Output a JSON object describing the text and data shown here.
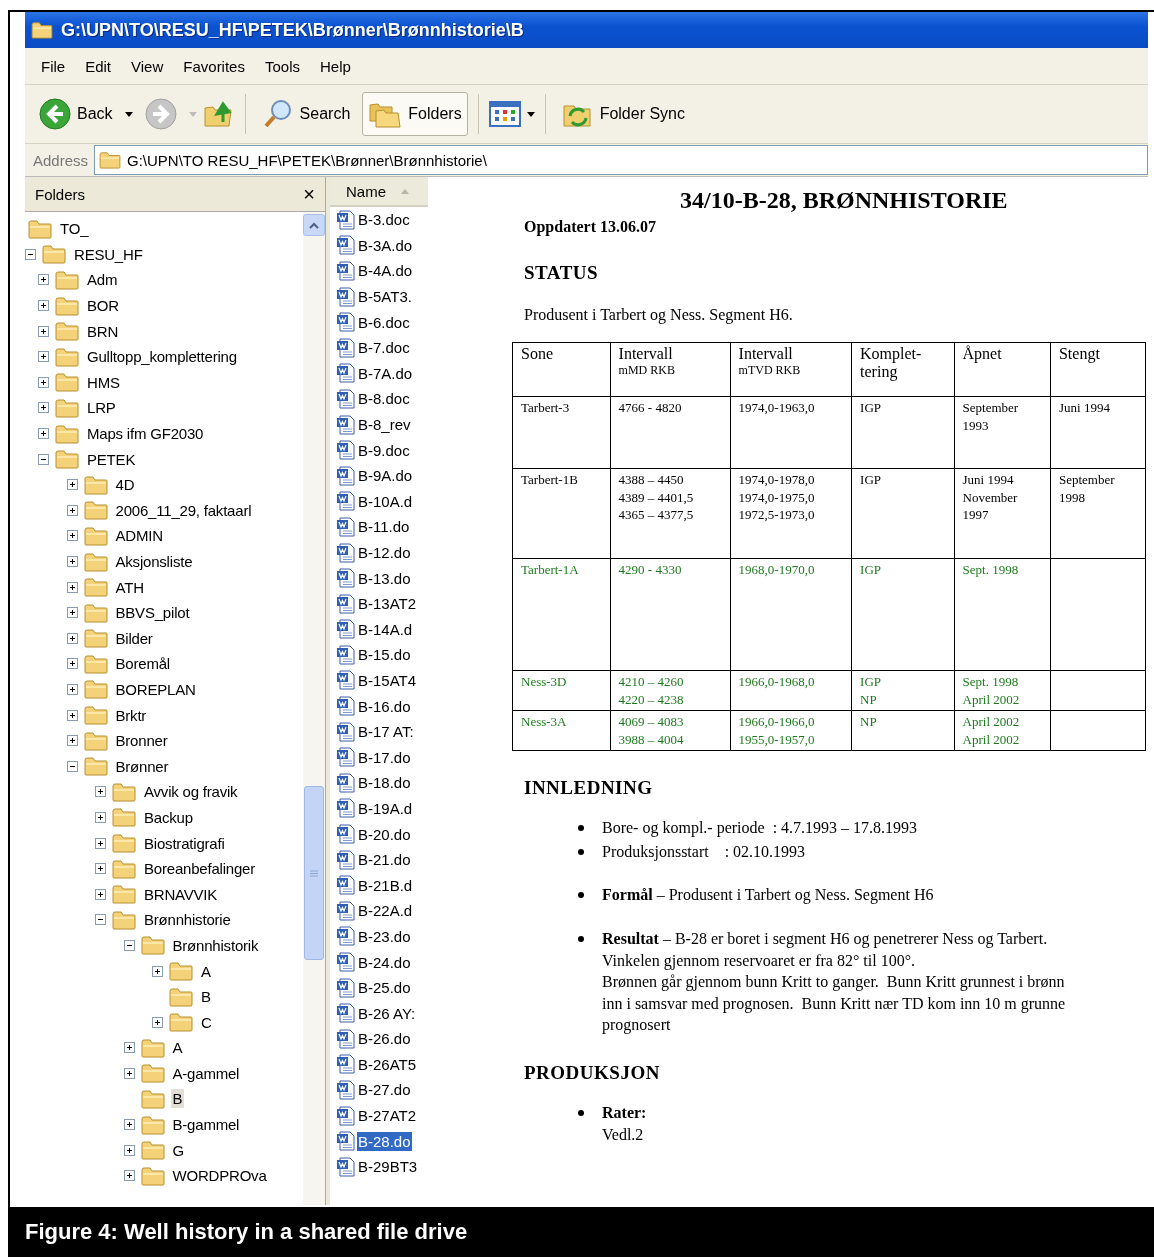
{
  "window": {
    "title": "G:\\UPN\\TO\\RESU_HF\\PETEK\\Brønner\\Brønnhistorie\\B"
  },
  "menu": [
    "File",
    "Edit",
    "View",
    "Favorites",
    "Tools",
    "Help"
  ],
  "toolbar": {
    "back": {
      "label": "Back",
      "disabled": false
    },
    "forward": {
      "disabled": true
    },
    "search": {
      "label": "Search",
      "selected": false
    },
    "folders": {
      "label": "Folders",
      "selected": true
    },
    "folder_sync": {
      "label": "Folder Sync"
    }
  },
  "address": {
    "label": "Address",
    "value": "G:\\UPN\\TO RESU_HF\\PETEK\\Brønner\\Brønnhistorie\\"
  },
  "folders_pane": {
    "title": "Folders",
    "close": "×",
    "tree": [
      {
        "label": "TO_",
        "kind": "root",
        "selected": false
      },
      {
        "label": "RESU_HF",
        "kind": "branch",
        "expanded": true,
        "selected": false,
        "children": [
          {
            "label": "Adm",
            "kind": "branch",
            "expanded": false,
            "selected": false
          },
          {
            "label": "BOR",
            "kind": "branch",
            "expanded": false,
            "selected": false
          },
          {
            "label": "BRN",
            "kind": "branch",
            "expanded": false,
            "selected": false
          },
          {
            "label": "Gulltopp_komplettering",
            "kind": "branch",
            "expanded": false,
            "selected": false
          },
          {
            "label": "HMS",
            "kind": "branch",
            "expanded": false,
            "selected": false
          },
          {
            "label": "LRP",
            "kind": "branch",
            "expanded": false,
            "selected": false
          },
          {
            "label": "Maps ifm GF2030",
            "kind": "branch",
            "expanded": false,
            "selected": false
          },
          {
            "label": "PETEK",
            "kind": "branch",
            "expanded": true,
            "selected": false,
            "children": [
              {
                "label": "4D",
                "kind": "branch",
                "expanded": false,
                "selected": false
              },
              {
                "label": "2006_11_29, faktaarl",
                "kind": "branch",
                "expanded": false,
                "selected": false
              },
              {
                "label": "ADMIN",
                "kind": "branch",
                "expanded": false,
                "selected": false
              },
              {
                "label": "Aksjonsliste",
                "kind": "branch",
                "expanded": false,
                "selected": false
              },
              {
                "label": "ATH",
                "kind": "branch",
                "expanded": false,
                "selected": false
              },
              {
                "label": "BBVS_pilot",
                "kind": "branch",
                "expanded": false,
                "selected": false
              },
              {
                "label": "Bilder",
                "kind": "branch",
                "expanded": false,
                "selected": false
              },
              {
                "label": "Boremål",
                "kind": "branch",
                "expanded": false,
                "selected": false
              },
              {
                "label": "BOREPLAN",
                "kind": "branch",
                "expanded": false,
                "selected": false
              },
              {
                "label": "Brktr",
                "kind": "branch",
                "expanded": false,
                "selected": false
              },
              {
                "label": "Bronner",
                "kind": "branch",
                "expanded": false,
                "selected": false
              },
              {
                "label": "Brønner",
                "kind": "branch",
                "expanded": true,
                "selected": false,
                "children": [
                  {
                    "label": "Avvik og fravik",
                    "kind": "branch",
                    "expanded": false,
                    "selected": false
                  },
                  {
                    "label": "Backup",
                    "kind": "branch",
                    "expanded": false,
                    "selected": false
                  },
                  {
                    "label": "Biostratigrafi",
                    "kind": "branch",
                    "expanded": false,
                    "selected": false
                  },
                  {
                    "label": "Boreanbefalinger",
                    "kind": "branch",
                    "expanded": false,
                    "selected": false
                  },
                  {
                    "label": "BRNAVVIK",
                    "kind": "branch",
                    "expanded": false,
                    "selected": false
                  },
                  {
                    "label": "Brønnhistorie",
                    "kind": "branch",
                    "expanded": true,
                    "selected": false,
                    "children": [
                      {
                        "label": "Brønnhistorik",
                        "kind": "branch",
                        "expanded": true,
                        "selected": false,
                        "children": [
                          {
                            "label": "A",
                            "kind": "branch",
                            "expanded": false,
                            "selected": false
                          },
                          {
                            "label": "B",
                            "kind": "leaf",
                            "selected": false
                          },
                          {
                            "label": "C",
                            "kind": "branch",
                            "expanded": false,
                            "selected": false
                          }
                        ]
                      },
                      {
                        "label": "A",
                        "kind": "branch",
                        "expanded": false,
                        "selected": false
                      },
                      {
                        "label": "A-gammel",
                        "kind": "branch",
                        "expanded": false,
                        "selected": false
                      },
                      {
                        "label": "B",
                        "kind": "leaf",
                        "selected": true
                      },
                      {
                        "label": "B-gammel",
                        "kind": "branch",
                        "expanded": false,
                        "selected": false
                      },
                      {
                        "label": "G",
                        "kind": "branch",
                        "expanded": false,
                        "selected": false
                      },
                      {
                        "label": "WORDPROva",
                        "kind": "branch",
                        "expanded": false,
                        "selected": false
                      }
                    ]
                  }
                ]
              }
            ]
          }
        ]
      }
    ]
  },
  "files_pane": {
    "column": "Name",
    "files": [
      {
        "name": "B-3.doc",
        "selected": false
      },
      {
        "name": "B-3A.do",
        "selected": false
      },
      {
        "name": "B-4A.do",
        "selected": false
      },
      {
        "name": "B-5AT3.",
        "selected": false
      },
      {
        "name": "B-6.doc",
        "selected": false
      },
      {
        "name": "B-7.doc",
        "selected": false
      },
      {
        "name": "B-7A.do",
        "selected": false
      },
      {
        "name": "B-8.doc",
        "selected": false
      },
      {
        "name": "B-8_rev",
        "selected": false
      },
      {
        "name": "B-9.doc",
        "selected": false
      },
      {
        "name": "B-9A.do",
        "selected": false
      },
      {
        "name": "B-10A.d",
        "selected": false
      },
      {
        "name": "B-11.do",
        "selected": false
      },
      {
        "name": "B-12.do",
        "selected": false
      },
      {
        "name": "B-13.do",
        "selected": false
      },
      {
        "name": "B-13AT2",
        "selected": false
      },
      {
        "name": "B-14A.d",
        "selected": false
      },
      {
        "name": "B-15.do",
        "selected": false
      },
      {
        "name": "B-15AT4",
        "selected": false
      },
      {
        "name": "B-16.do",
        "selected": false
      },
      {
        "name": "B-17 AT:",
        "selected": false
      },
      {
        "name": "B-17.do",
        "selected": false
      },
      {
        "name": "B-18.do",
        "selected": false
      },
      {
        "name": "B-19A.d",
        "selected": false
      },
      {
        "name": "B-20.do",
        "selected": false
      },
      {
        "name": "B-21.do",
        "selected": false
      },
      {
        "name": "B-21B.d",
        "selected": false
      },
      {
        "name": "B-22A.d",
        "selected": false
      },
      {
        "name": "B-23.do",
        "selected": false
      },
      {
        "name": "B-24.do",
        "selected": false
      },
      {
        "name": "B-25.do",
        "selected": false
      },
      {
        "name": "B-26 AY:",
        "selected": false
      },
      {
        "name": "B-26.do",
        "selected": false
      },
      {
        "name": "B-26AT5",
        "selected": false
      },
      {
        "name": "B-27.do",
        "selected": false
      },
      {
        "name": "B-27AT2",
        "selected": false
      },
      {
        "name": "B-28.do",
        "selected": true
      },
      {
        "name": "B-29BT3",
        "selected": false
      }
    ]
  },
  "document": {
    "title": "34/10-B-28, BRØNNHISTORIE",
    "updated": "Oppdatert 13.06.07",
    "sections": [
      {
        "heading": "STATUS",
        "paragraph": "Produsent i Tarbert og Ness. Segment H6.",
        "table": {
          "columns": [
            {
              "text": "Sone"
            },
            {
              "text": "Intervall",
              "sub": "mMD RKB"
            },
            {
              "text": "Intervall",
              "sub": "mTVD RKB"
            },
            {
              "text": "Komplet-\ntering"
            },
            {
              "text": "Åpnet"
            },
            {
              "text": "Stengt"
            }
          ],
          "rows": [
            {
              "color": "#000000",
              "cells": [
                "Tarbert-3",
                "4766 - 4820",
                "1974,0-1963,0",
                "IGP",
                "September\n1993",
                "Juni 1994"
              ]
            },
            {
              "color": "#000000",
              "cells": [
                "Tarbert-1B",
                "4388 – 4450\n4389 – 4401,5\n4365 – 4377,5",
                "1974,0-1978,0\n1974,0-1975,0\n1972,5-1973,0",
                "IGP",
                "Juni 1994\nNovember\n1997",
                "September\n1998"
              ]
            },
            {
              "color": "#1e7a1e",
              "cells": [
                "Tarbert-1A",
                "4290 - 4330",
                "1968,0-1970,0",
                "IGP",
                "Sept. 1998",
                ""
              ]
            },
            {
              "color": "#1e7a1e",
              "cells": [
                "Ness-3D",
                "4210 – 4260\n4220 – 4238",
                "1966,0-1968,0",
                "IGP\nNP",
                "Sept. 1998\nApril 2002",
                ""
              ]
            },
            {
              "color": "#1e7a1e",
              "cells": [
                "Ness-3A",
                "4069 – 4083\n3988 – 4004",
                "1966,0-1966,0\n1955,0-1957,0",
                "NP",
                "April 2002\nApril 2002",
                ""
              ]
            }
          ]
        }
      },
      {
        "heading": "INNLEDNING",
        "bullet_groups": [
          [
            "Bore- og kompl.- periode  : 4.7.1993 – 17.8.1993",
            "Produksjonsstart    : 02.10.1993"
          ],
          [
            "**Formål** – Produsent i Tarbert og Ness. Segment H6"
          ],
          [
            "**Resultat** – B-28 er boret i segment H6 og penetrerer Ness og Tarbert.\nVinkelen gjennom reservoaret er fra 82° til 100°.\nBrønnen går gjennom bunn Kritt to ganger.  Bunn Kritt grunnest i brønn\ninn i samsvar med prognosen.  Bunn Kritt nær TD kom inn 10 m grunne\nprognosert"
          ]
        ]
      },
      {
        "heading": "PRODUKSJON",
        "bullet_groups": [
          [
            "**Rater:**\nVedl.2"
          ]
        ]
      }
    ]
  },
  "caption": "Figure 4: Well history in a shared file drive"
}
